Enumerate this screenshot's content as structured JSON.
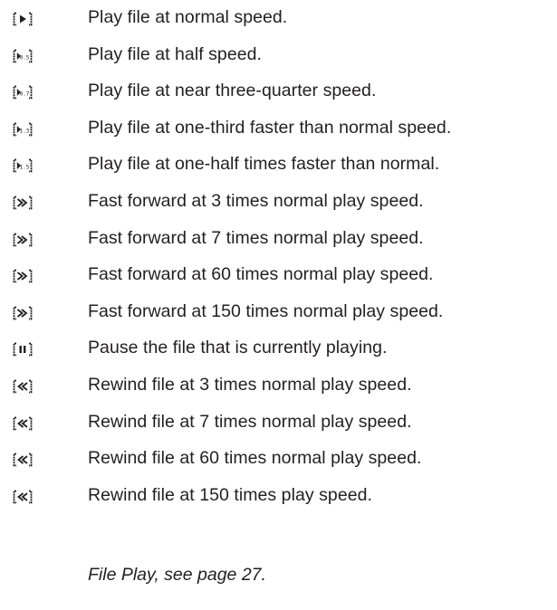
{
  "rows": [
    {
      "icon": "play-icon",
      "glyph": "play",
      "sub": "",
      "label": "Play file at normal speed."
    },
    {
      "icon": "play-half-speed-icon",
      "glyph": "play",
      "sub": "0.5",
      "label": "Play file at half speed."
    },
    {
      "icon": "play-0-7-speed-icon",
      "glyph": "play",
      "sub": "0.7",
      "label": "Play file at near three-quarter speed."
    },
    {
      "icon": "play-1-3-speed-icon",
      "glyph": "play",
      "sub": "1.3",
      "label": "Play file at one-third faster than normal speed."
    },
    {
      "icon": "play-1-5-speed-icon",
      "glyph": "play",
      "sub": "1.5",
      "label": "Play file at one-half times faster than normal."
    },
    {
      "icon": "fast-forward-icon",
      "glyph": "ff",
      "sub": "",
      "label": "Fast forward at 3 times normal play speed."
    },
    {
      "icon": "fast-forward-icon",
      "glyph": "ff",
      "sub": "",
      "label": "Fast forward at 7 times normal play speed."
    },
    {
      "icon": "fast-forward-icon",
      "glyph": "ff",
      "sub": "",
      "label": "Fast forward at 60 times normal play speed."
    },
    {
      "icon": "fast-forward-icon",
      "glyph": "ff",
      "sub": "",
      "label": "Fast forward at 150 times normal play speed."
    },
    {
      "icon": "pause-icon",
      "glyph": "pause",
      "sub": "",
      "label": "Pause the file that is currently playing."
    },
    {
      "icon": "rewind-icon",
      "glyph": "rew",
      "sub": "",
      "label": "Rewind file at 3 times normal play speed."
    },
    {
      "icon": "rewind-icon",
      "glyph": "rew",
      "sub": "",
      "label": "Rewind file at 7 times normal play speed."
    },
    {
      "icon": "rewind-icon",
      "glyph": "rew",
      "sub": "",
      "label": "Rewind file at 60 times normal play speed."
    },
    {
      "icon": "rewind-icon",
      "glyph": "rew",
      "sub": "",
      "label": "Rewind file at 150 times play speed."
    }
  ],
  "footer": "File Play, see page 27.",
  "colors": {
    "text": "#231f20",
    "icon": "#231f20"
  }
}
